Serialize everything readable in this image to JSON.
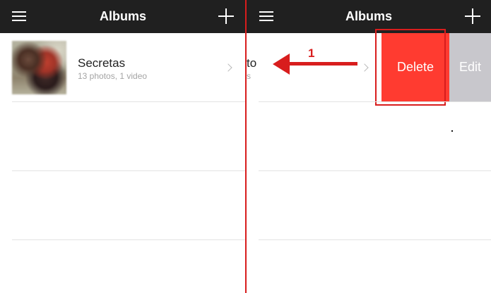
{
  "left_panel": {
    "header": {
      "title": "Albums",
      "menu_icon": "menu-icon",
      "add_icon": "plus-icon"
    },
    "album": {
      "title": "Secretas",
      "subtitle": "13 photos, 1 video",
      "thumbnail": "blurred-photo-thumbnail",
      "chevron_icon": "chevron-right-icon"
    }
  },
  "right_panel": {
    "header": {
      "title": "Albums",
      "menu_icon": "menu-icon",
      "add_icon": "plus-icon"
    },
    "swiped_row": {
      "title_fragment": "to",
      "subtitle_fragment": "s",
      "chevron_icon": "chevron-right-icon"
    },
    "actions": {
      "delete_label": "Delete",
      "edit_label": "Edit",
      "delete_color": "#ff3b30",
      "edit_color": "#c8c7cc"
    }
  },
  "annotation": {
    "step_number": "1",
    "arrow_direction": "left",
    "color": "#d81d1d"
  },
  "colors": {
    "navbar": "#202020",
    "divider": "#e3e3e3",
    "title_text": "#222222",
    "subtitle_text": "#a4a4a4"
  }
}
